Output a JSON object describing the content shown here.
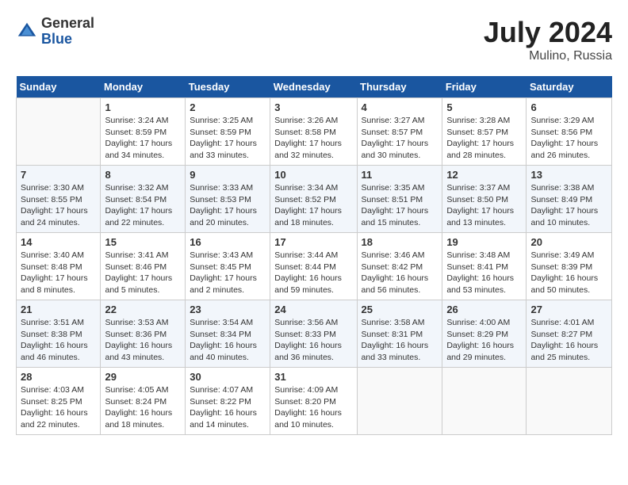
{
  "header": {
    "logo_general": "General",
    "logo_blue": "Blue",
    "month_year": "July 2024",
    "location": "Mulino, Russia"
  },
  "columns": [
    "Sunday",
    "Monday",
    "Tuesday",
    "Wednesday",
    "Thursday",
    "Friday",
    "Saturday"
  ],
  "weeks": [
    [
      {
        "day": "",
        "info": ""
      },
      {
        "day": "1",
        "info": "Sunrise: 3:24 AM\nSunset: 8:59 PM\nDaylight: 17 hours\nand 34 minutes."
      },
      {
        "day": "2",
        "info": "Sunrise: 3:25 AM\nSunset: 8:59 PM\nDaylight: 17 hours\nand 33 minutes."
      },
      {
        "day": "3",
        "info": "Sunrise: 3:26 AM\nSunset: 8:58 PM\nDaylight: 17 hours\nand 32 minutes."
      },
      {
        "day": "4",
        "info": "Sunrise: 3:27 AM\nSunset: 8:57 PM\nDaylight: 17 hours\nand 30 minutes."
      },
      {
        "day": "5",
        "info": "Sunrise: 3:28 AM\nSunset: 8:57 PM\nDaylight: 17 hours\nand 28 minutes."
      },
      {
        "day": "6",
        "info": "Sunrise: 3:29 AM\nSunset: 8:56 PM\nDaylight: 17 hours\nand 26 minutes."
      }
    ],
    [
      {
        "day": "7",
        "info": "Sunrise: 3:30 AM\nSunset: 8:55 PM\nDaylight: 17 hours\nand 24 minutes."
      },
      {
        "day": "8",
        "info": "Sunrise: 3:32 AM\nSunset: 8:54 PM\nDaylight: 17 hours\nand 22 minutes."
      },
      {
        "day": "9",
        "info": "Sunrise: 3:33 AM\nSunset: 8:53 PM\nDaylight: 17 hours\nand 20 minutes."
      },
      {
        "day": "10",
        "info": "Sunrise: 3:34 AM\nSunset: 8:52 PM\nDaylight: 17 hours\nand 18 minutes."
      },
      {
        "day": "11",
        "info": "Sunrise: 3:35 AM\nSunset: 8:51 PM\nDaylight: 17 hours\nand 15 minutes."
      },
      {
        "day": "12",
        "info": "Sunrise: 3:37 AM\nSunset: 8:50 PM\nDaylight: 17 hours\nand 13 minutes."
      },
      {
        "day": "13",
        "info": "Sunrise: 3:38 AM\nSunset: 8:49 PM\nDaylight: 17 hours\nand 10 minutes."
      }
    ],
    [
      {
        "day": "14",
        "info": "Sunrise: 3:40 AM\nSunset: 8:48 PM\nDaylight: 17 hours\nand 8 minutes."
      },
      {
        "day": "15",
        "info": "Sunrise: 3:41 AM\nSunset: 8:46 PM\nDaylight: 17 hours\nand 5 minutes."
      },
      {
        "day": "16",
        "info": "Sunrise: 3:43 AM\nSunset: 8:45 PM\nDaylight: 17 hours\nand 2 minutes."
      },
      {
        "day": "17",
        "info": "Sunrise: 3:44 AM\nSunset: 8:44 PM\nDaylight: 16 hours\nand 59 minutes."
      },
      {
        "day": "18",
        "info": "Sunrise: 3:46 AM\nSunset: 8:42 PM\nDaylight: 16 hours\nand 56 minutes."
      },
      {
        "day": "19",
        "info": "Sunrise: 3:48 AM\nSunset: 8:41 PM\nDaylight: 16 hours\nand 53 minutes."
      },
      {
        "day": "20",
        "info": "Sunrise: 3:49 AM\nSunset: 8:39 PM\nDaylight: 16 hours\nand 50 minutes."
      }
    ],
    [
      {
        "day": "21",
        "info": "Sunrise: 3:51 AM\nSunset: 8:38 PM\nDaylight: 16 hours\nand 46 minutes."
      },
      {
        "day": "22",
        "info": "Sunrise: 3:53 AM\nSunset: 8:36 PM\nDaylight: 16 hours\nand 43 minutes."
      },
      {
        "day": "23",
        "info": "Sunrise: 3:54 AM\nSunset: 8:34 PM\nDaylight: 16 hours\nand 40 minutes."
      },
      {
        "day": "24",
        "info": "Sunrise: 3:56 AM\nSunset: 8:33 PM\nDaylight: 16 hours\nand 36 minutes."
      },
      {
        "day": "25",
        "info": "Sunrise: 3:58 AM\nSunset: 8:31 PM\nDaylight: 16 hours\nand 33 minutes."
      },
      {
        "day": "26",
        "info": "Sunrise: 4:00 AM\nSunset: 8:29 PM\nDaylight: 16 hours\nand 29 minutes."
      },
      {
        "day": "27",
        "info": "Sunrise: 4:01 AM\nSunset: 8:27 PM\nDaylight: 16 hours\nand 25 minutes."
      }
    ],
    [
      {
        "day": "28",
        "info": "Sunrise: 4:03 AM\nSunset: 8:25 PM\nDaylight: 16 hours\nand 22 minutes."
      },
      {
        "day": "29",
        "info": "Sunrise: 4:05 AM\nSunset: 8:24 PM\nDaylight: 16 hours\nand 18 minutes."
      },
      {
        "day": "30",
        "info": "Sunrise: 4:07 AM\nSunset: 8:22 PM\nDaylight: 16 hours\nand 14 minutes."
      },
      {
        "day": "31",
        "info": "Sunrise: 4:09 AM\nSunset: 8:20 PM\nDaylight: 16 hours\nand 10 minutes."
      },
      {
        "day": "",
        "info": ""
      },
      {
        "day": "",
        "info": ""
      },
      {
        "day": "",
        "info": ""
      }
    ]
  ]
}
